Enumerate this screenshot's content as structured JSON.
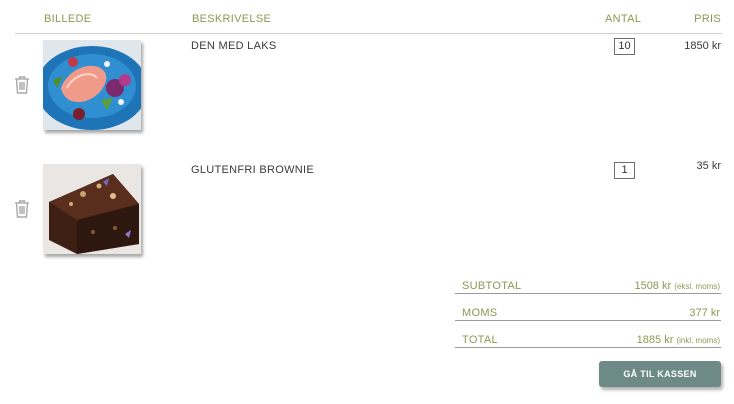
{
  "header": {
    "image_label": "BILLEDE",
    "description_label": "BESKRIVELSE",
    "quantity_label": "ANTAL",
    "price_label": "PRIS"
  },
  "items": [
    {
      "name": "DEN MED LAKS",
      "quantity": "10",
      "price": "1850 kr",
      "icon": "trash-icon"
    },
    {
      "name": "GLUTENFRI BROWNIE",
      "quantity": "1",
      "price": "35 kr",
      "icon": "trash-icon"
    }
  ],
  "totals": {
    "subtotal_label": "SUBTOTAL",
    "subtotal_value": "1508 kr",
    "subtotal_note": "(eksl. moms)",
    "vat_label": "MOMS",
    "vat_value": "377 kr",
    "total_label": "TOTAL",
    "total_value": "1885 kr",
    "total_note": "(inkl. moms)"
  },
  "checkout_label": "GÅ TIL KASSEN",
  "colors": {
    "accent": "#8a9a52",
    "button": "#6e8a86"
  }
}
